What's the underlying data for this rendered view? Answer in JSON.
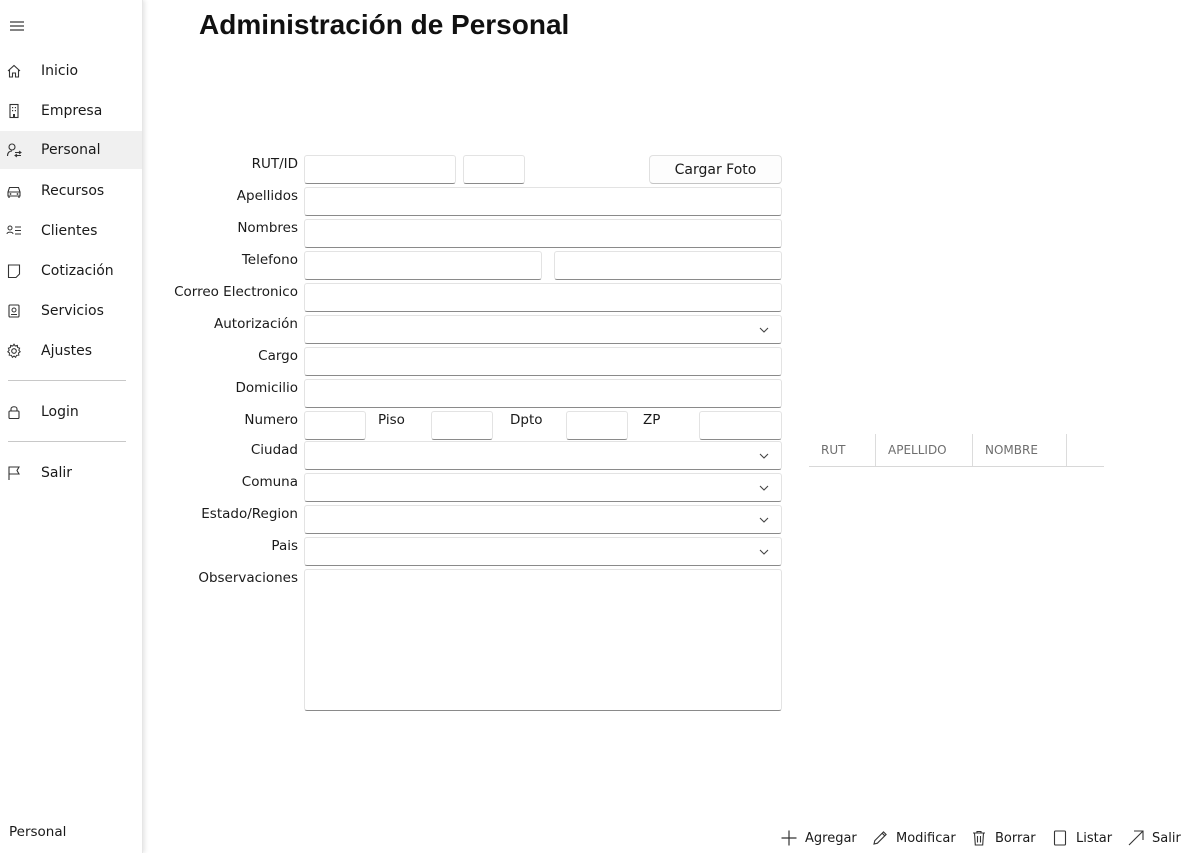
{
  "sidebar": {
    "items": [
      {
        "label": "Inicio",
        "icon": "home-icon"
      },
      {
        "label": "Empresa",
        "icon": "building-icon"
      },
      {
        "label": "Personal",
        "icon": "person-swap-icon",
        "selected": true
      },
      {
        "label": "Recursos",
        "icon": "car-icon"
      },
      {
        "label": "Clientes",
        "icon": "contact-list-icon"
      },
      {
        "label": "Cotización",
        "icon": "document-icon"
      },
      {
        "label": "Servicios",
        "icon": "service-icon"
      },
      {
        "label": "Ajustes",
        "icon": "gear-icon"
      }
    ],
    "login_label": "Login",
    "exit_label": "Salir",
    "footer": "Personal"
  },
  "page": {
    "title": "Administración de Personal"
  },
  "form": {
    "rut_label": "RUT/ID",
    "photo_button": "Cargar Foto",
    "apellidos_label": "Apellidos",
    "nombres_label": "Nombres",
    "telefono_label": "Telefono",
    "correo_label": "Correo Electronico",
    "autorizacion_label": "Autorización",
    "cargo_label": "Cargo",
    "domicilio_label": "Domicilio",
    "numero_label": "Numero",
    "piso_label": "Piso",
    "dpto_label": "Dpto",
    "zp_label": "ZP",
    "ciudad_label": "Ciudad",
    "comuna_label": "Comuna",
    "estado_label": "Estado/Region",
    "pais_label": "Pais",
    "observaciones_label": "Observaciones"
  },
  "grid": {
    "columns": [
      "RUT",
      "APELLIDO",
      "NOMBRE"
    ]
  },
  "commands": {
    "add": "Agregar",
    "edit": "Modificar",
    "delete": "Borrar",
    "list": "Listar",
    "exit": "Salir"
  }
}
